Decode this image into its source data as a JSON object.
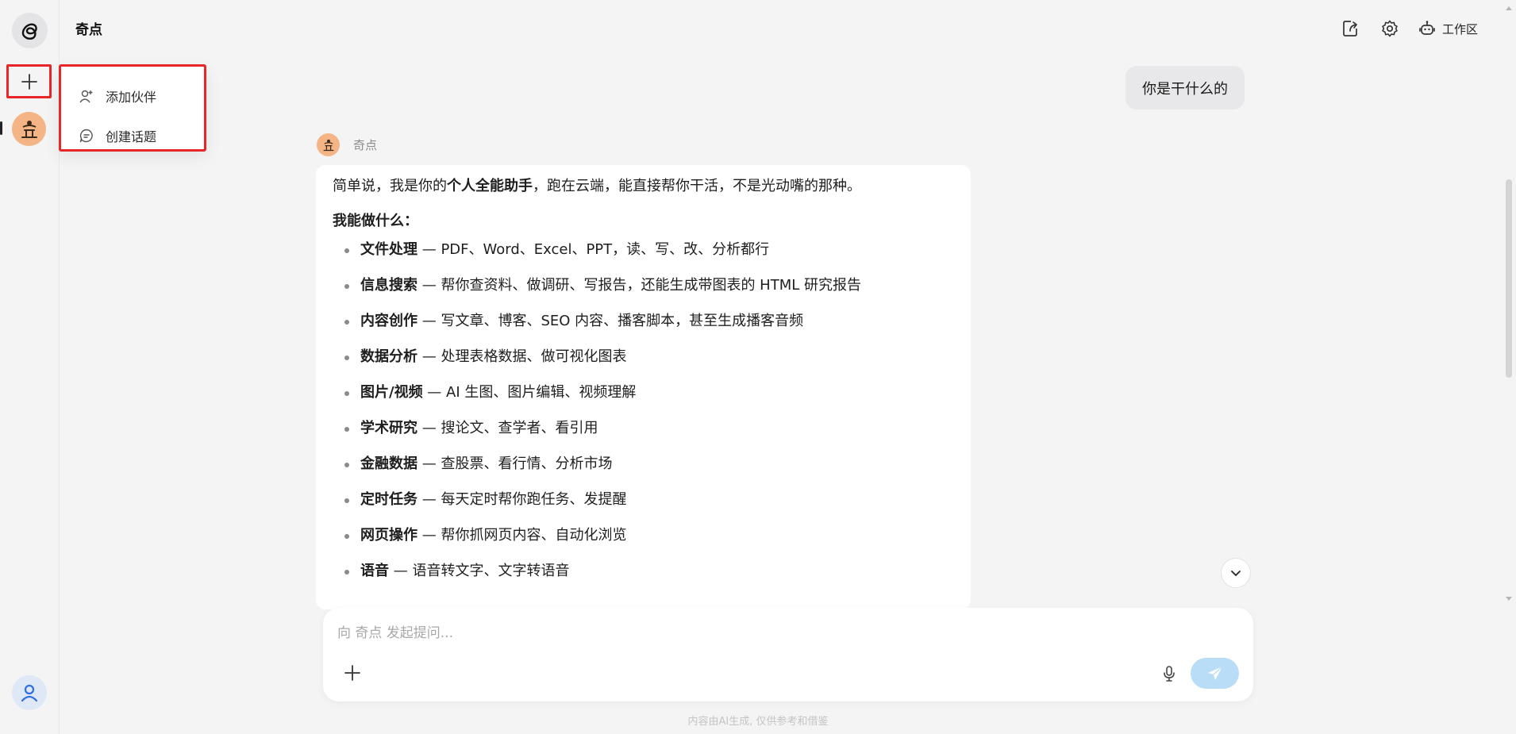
{
  "header": {
    "title": "奇点",
    "workspace_label": "工作区"
  },
  "menu": {
    "items": [
      {
        "label": "添加伙伴",
        "icon": "add-user-icon"
      },
      {
        "label": "创建话题",
        "icon": "chat-icon"
      }
    ]
  },
  "conversation": {
    "user_message": "你是干什么的",
    "bot_name": "奇点",
    "intro_prefix": "简单说，我是你的",
    "intro_bold": "个人全能助手",
    "intro_suffix": "，跑在云端，能直接帮你干活，不是光动嘴的那种。",
    "capabilities_heading": "我能做什么：",
    "features": [
      {
        "title": "文件处理",
        "desc": " — PDF、Word、Excel、PPT，读、写、改、分析都行"
      },
      {
        "title": "信息搜索",
        "desc": " — 帮你查资料、做调研、写报告，还能生成带图表的 HTML 研究报告"
      },
      {
        "title": "内容创作",
        "desc": " — 写文章、博客、SEO 内容、播客脚本，甚至生成播客音频"
      },
      {
        "title": "数据分析",
        "desc": " — 处理表格数据、做可视化图表"
      },
      {
        "title": "图片/视频",
        "desc": " — AI 生图、图片编辑、视频理解"
      },
      {
        "title": "学术研究",
        "desc": " — 搜论文、查学者、看引用"
      },
      {
        "title": "金融数据",
        "desc": " — 查股票、看行情、分析市场"
      },
      {
        "title": "定时任务",
        "desc": " — 每天定时帮你跑任务、发提醒"
      },
      {
        "title": "网页操作",
        "desc": " — 帮你抓网页内容、自动化浏览"
      },
      {
        "title": "语音",
        "desc": " — 语音转文字、文字转语音"
      }
    ]
  },
  "composer": {
    "placeholder": "向 奇点 发起提问..."
  },
  "footer": {
    "disclaimer": "内容由AI生成, 仅供参考和借鉴"
  },
  "colors": {
    "highlight_border": "#e8262a",
    "send_button": "#b9dcf7",
    "agent_avatar": "#f4b485"
  }
}
